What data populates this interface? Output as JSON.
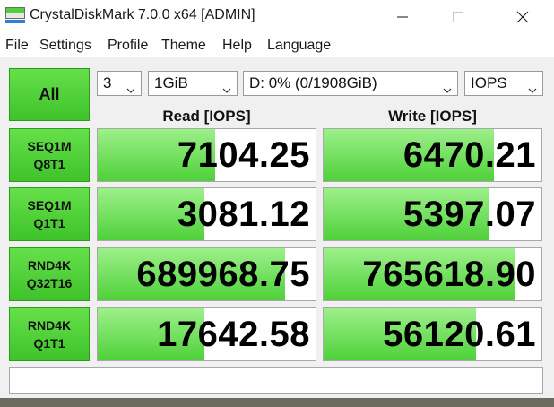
{
  "window": {
    "title": "CrystalDiskMark 7.0.0 x64 [ADMIN]"
  },
  "menu": [
    "File",
    "Settings",
    "Profile",
    "Theme",
    "Help",
    "Language"
  ],
  "controls": {
    "all_label": "All",
    "count": "3",
    "size": "1GiB",
    "drive": "D: 0% (0/1908GiB)",
    "unit": "IOPS"
  },
  "headers": {
    "read": "Read [IOPS]",
    "write": "Write [IOPS]"
  },
  "rows": [
    {
      "line1": "SEQ1M",
      "line2": "Q8T1",
      "read": "7104.25",
      "write": "6470.21",
      "read_fill": 0.54,
      "write_fill": 0.78
    },
    {
      "line1": "SEQ1M",
      "line2": "Q1T1",
      "read": "3081.12",
      "write": "5397.07",
      "read_fill": 0.49,
      "write_fill": 0.76
    },
    {
      "line1": "RND4K",
      "line2": "Q32T16",
      "read": "689968.75",
      "write": "765618.90",
      "read_fill": 0.86,
      "write_fill": 0.88
    },
    {
      "line1": "RND4K",
      "line2": "Q1T1",
      "read": "17642.58",
      "write": "56120.61",
      "read_fill": 0.49,
      "write_fill": 0.7
    }
  ],
  "comment": "",
  "colors": {
    "accent_green": "#3fc32a",
    "bar_green": "#4fd13a"
  }
}
